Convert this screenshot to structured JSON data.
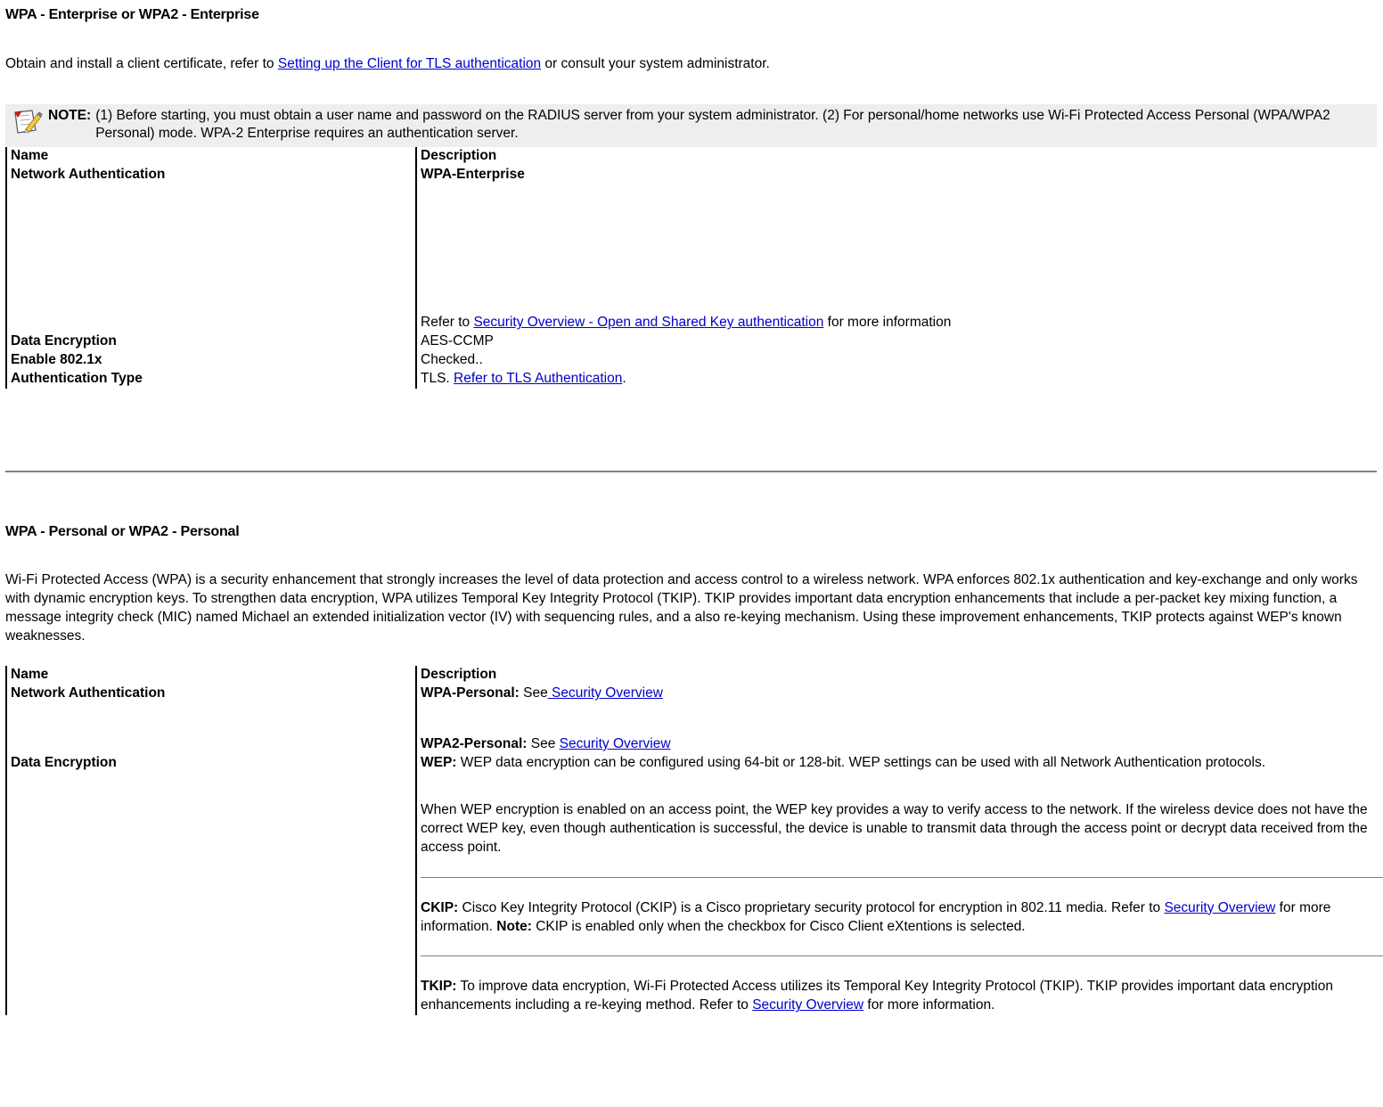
{
  "enterprise_section": {
    "title": "WPA - Enterprise or WPA2 - Enterprise",
    "intro_prefix": "Obtain and install a client certificate, refer to ",
    "intro_link": "Setting up the Client for TLS authentication",
    "intro_suffix": " or consult your system administrator.",
    "note": {
      "icon": "notepad-pencil-icon",
      "label": "NOTE:",
      "text": "(1) Before starting, you must obtain a user name and password on the RADIUS server from your system administrator. (2) For personal/home networks use Wi-Fi Protected Access Personal (WPA/WPA2 Personal) mode. WPA-2 Enterprise requires an authentication server."
    },
    "table": {
      "headers": [
        "Name",
        "Description"
      ],
      "rows": [
        {
          "name": "Network Authentication",
          "value_bold": "WPA-Enterprise",
          "refer_prefix": "Refer to ",
          "refer_link": "Security Overview - Open and Shared Key authentication",
          "refer_suffix": " for more information"
        },
        {
          "name": "Data Encryption",
          "value": "AES-CCMP"
        },
        {
          "name": "Enable 802.1x",
          "value": "Checked.."
        },
        {
          "name": "Authentication Type",
          "value_prefix": "TLS. ",
          "value_link": "Refer to TLS Authentication",
          "value_suffix": "."
        }
      ]
    }
  },
  "personal_section": {
    "title": "WPA - Personal or WPA2 - Personal",
    "intro": "Wi-Fi Protected Access (WPA) is a security enhancement that strongly increases the level of data protection and access control to a wireless network. WPA enforces 802.1x authentication and key-exchange and only works with dynamic encryption keys. To strengthen data encryption, WPA utilizes Temporal Key Integrity Protocol (TKIP). TKIP provides important data encryption enhancements that include a per-packet key mixing function, a message integrity check (MIC) named Michael an extended initialization vector (IV) with sequencing rules, and a also re-keying mechanism. Using these improvement enhancements, TKIP protects against WEP's known weaknesses.",
    "table": {
      "headers": [
        "Name",
        "Description"
      ],
      "network_auth": {
        "name": "Network Authentication",
        "wpa_personal_label": "WPA-Personal:",
        "wpa_personal_text": " See",
        "wpa_personal_link": " Security Overview",
        "wpa2_personal_label": "WPA2-Personal:",
        "wpa2_personal_text": " See ",
        "wpa2_personal_link": "Security Overview"
      },
      "data_encryption": {
        "name": "Data Encryption",
        "wep_label": "WEP:",
        "wep_text": " WEP data encryption can be configured using 64-bit or 128-bit. WEP settings can be used with all Network Authentication protocols.",
        "wep_para2": "When WEP encryption is enabled on an access point, the WEP key provides a way to verify access to the network. If the wireless device does not have the correct WEP key, even though authentication is successful, the device is unable to transmit data through the access point or decrypt data received from the access point.",
        "ckip_label": "CKIP:",
        "ckip_text1": " Cisco Key Integrity Protocol (CKIP) is a Cisco proprietary security protocol for encryption in 802.11 media. Refer to ",
        "ckip_link": "Security Overview",
        "ckip_text2": " for more information. ",
        "ckip_note_label": "Note:",
        "ckip_text3": " CKIP is enabled only when the checkbox for Cisco Client eXtentions is selected.",
        "tkip_label": "TKIP:",
        "tkip_text1": " To improve data encryption, Wi-Fi Protected Access utilizes its Temporal Key Integrity Protocol (TKIP). TKIP provides important data encryption enhancements including a re-keying method. Refer to ",
        "tkip_link": "Security Overview",
        "tkip_text2": " for more information."
      }
    }
  },
  "colors": {
    "link": "#0000cc",
    "note_background": "#eeeeee",
    "rule": "#808080",
    "text": "#000000"
  }
}
